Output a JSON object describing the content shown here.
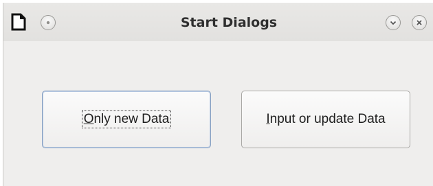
{
  "window": {
    "title": "Start Dialogs"
  },
  "titlebar": {
    "app_icon": "document-icon",
    "menu_icon": "window-menu-icon",
    "minimize_icon": "chevron-down-icon",
    "close_icon": "close-icon"
  },
  "buttons": {
    "only_new": {
      "mnemonic": "O",
      "label_rest": "nly new Data",
      "default": true,
      "focused": true
    },
    "input_update": {
      "mnemonic": "I",
      "label_rest": "nput or update Data",
      "default": false,
      "focused": false
    }
  },
  "colors": {
    "window_bg": "#efeeed",
    "titlebar_bg": "#e4e3e1",
    "default_button_border": "#8aa2c2"
  }
}
